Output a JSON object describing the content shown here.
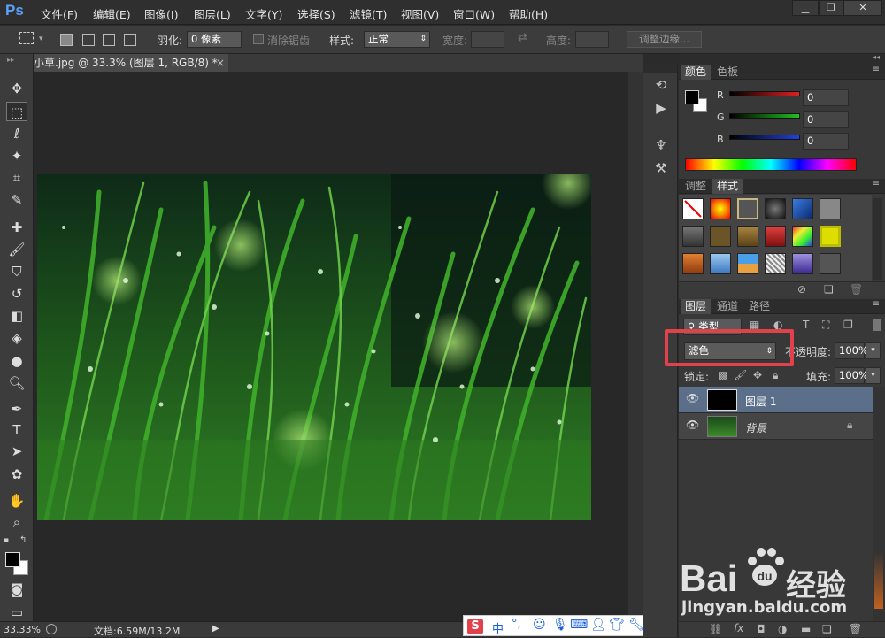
{
  "app": {
    "logo": "Ps"
  },
  "menu": [
    "文件(F)",
    "编辑(E)",
    "图像(I)",
    "图层(L)",
    "文字(Y)",
    "选择(S)",
    "滤镜(T)",
    "视图(V)",
    "窗口(W)",
    "帮助(H)"
  ],
  "options": {
    "feather_label": "羽化:",
    "feather_value": "0 像素",
    "antialias_label": "消除锯齿",
    "style_label": "样式:",
    "style_value": "正常",
    "width_label": "宽度:",
    "height_label": "高度:",
    "refine_button": "调整边缘..."
  },
  "document": {
    "tab_title": "小草.jpg @ 33.3% (图层 1, RGB/8) *",
    "close": "×"
  },
  "status": {
    "zoom": "33.33%",
    "doc_info": "文档:6.59M/13.2M"
  },
  "color_panel": {
    "tabs": [
      "颜色",
      "色板"
    ],
    "channels": [
      {
        "name": "R",
        "value": "0",
        "color": "#e02020"
      },
      {
        "name": "G",
        "value": "0",
        "color": "#20c020"
      },
      {
        "name": "B",
        "value": "0",
        "color": "#2040e0"
      }
    ]
  },
  "styles_panel": {
    "tabs": [
      "调整",
      "样式"
    ]
  },
  "layers_panel": {
    "tabs": [
      "图层",
      "通道",
      "路径"
    ],
    "filter_label": "类型",
    "blend_mode": "滤色",
    "opacity_label": "不透明度:",
    "opacity_value": "100%",
    "lock_label": "锁定:",
    "fill_label": "填充:",
    "fill_value": "100%",
    "layers": [
      {
        "name": "图层 1",
        "selected": true
      },
      {
        "name": "背景",
        "selected": false
      }
    ]
  },
  "ime_bar": {
    "label": "中"
  },
  "watermark": {
    "brand": "Bai",
    "brand2": "经验",
    "url": "jingyan.baidu.com"
  },
  "colors": {
    "accent": "#e0414b",
    "ps_blue": "#5aa2ff"
  }
}
